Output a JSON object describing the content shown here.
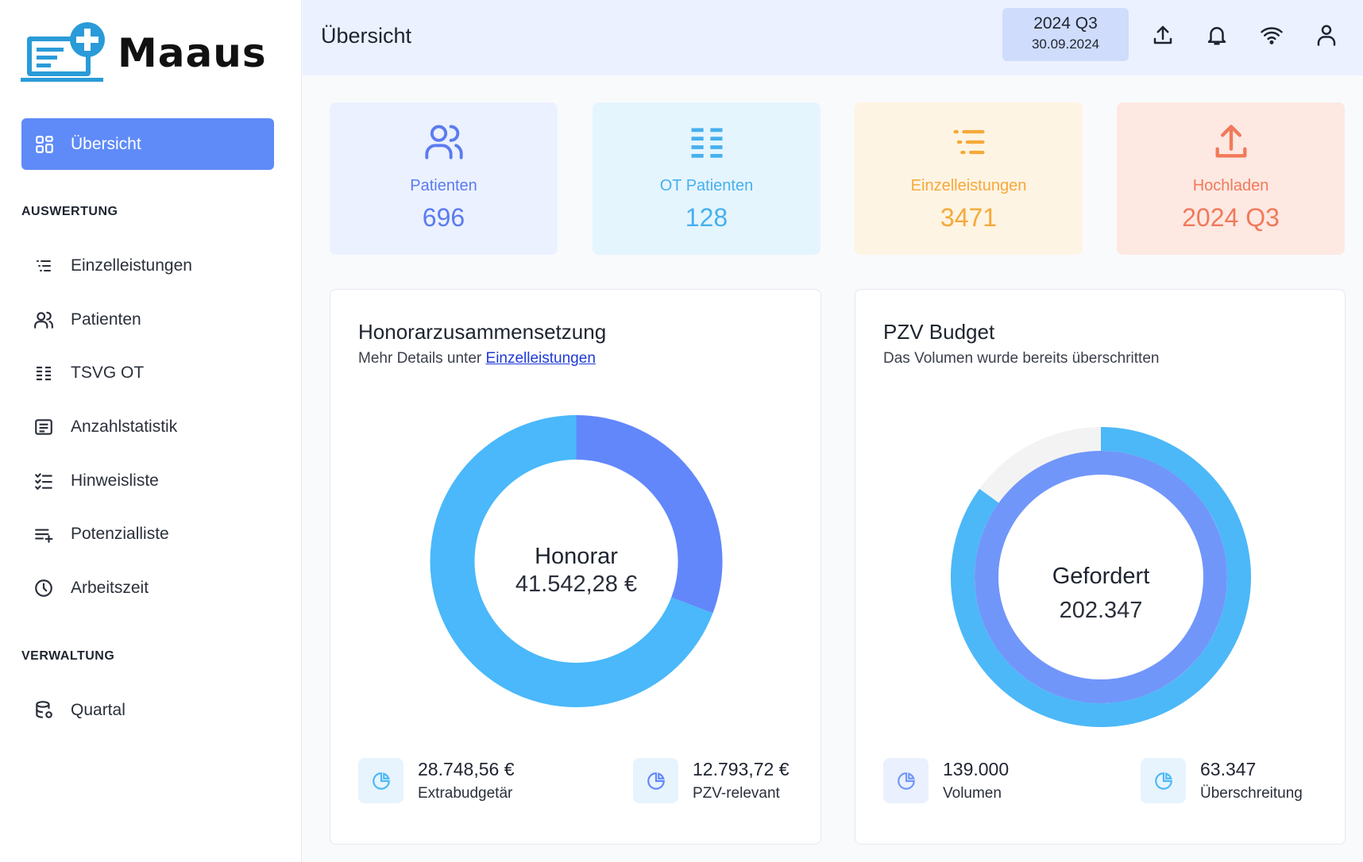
{
  "app": {
    "name": "Maaus"
  },
  "sidebar": {
    "active_item": "Übersicht",
    "section_auswertung": "AUSWERTUNG",
    "section_verwaltung": "VERWALTUNG",
    "items": [
      {
        "label": "Einzelleistungen",
        "icon": "list-icon"
      },
      {
        "label": "Patienten",
        "icon": "users-icon"
      },
      {
        "label": "TSVG OT",
        "icon": "table-list-icon"
      },
      {
        "label": "Anzahlstatistik",
        "icon": "document-list-icon"
      },
      {
        "label": "Hinweisliste",
        "icon": "checklist-icon"
      },
      {
        "label": "Potenzialliste",
        "icon": "playlist-add-icon"
      },
      {
        "label": "Arbeitszeit",
        "icon": "clock-icon"
      }
    ],
    "admin_items": [
      {
        "label": "Quartal",
        "icon": "database-icon"
      }
    ]
  },
  "header": {
    "title": "Übersicht",
    "quarter": "2024 Q3",
    "date": "30.09.2024"
  },
  "stats": [
    {
      "label": "Patienten",
      "value": "696",
      "color": "#5b7bf0",
      "bg": "#ebf1fe"
    },
    {
      "label": "OT Patienten",
      "value": "128",
      "color": "#47b0ee",
      "bg": "#e5f5fe"
    },
    {
      "label": "Einzelleistungen",
      "value": "3471",
      "color": "#f5a93a",
      "bg": "#fef4e3"
    },
    {
      "label": "Hochladen",
      "value": "2024 Q3",
      "color": "#f07a5a",
      "bg": "#fde8e2"
    }
  ],
  "honorar": {
    "title": "Honorarzusammensetzung",
    "subtitle_prefix": "Mehr Details unter",
    "subtitle_link": "Einzelleistungen",
    "center_label": "Honorar",
    "center_value": "41.542,28 €",
    "legend": [
      {
        "value": "28.748,56 €",
        "label": "Extrabudgetär"
      },
      {
        "value": "12.793,72 €",
        "label": "PZV-relevant"
      }
    ]
  },
  "pzv": {
    "title": "PZV Budget",
    "subtitle": "Das Volumen wurde bereits überschritten",
    "center_label": "Gefordert",
    "center_value": "202.347",
    "legend": [
      {
        "value": "139.000",
        "label": "Volumen"
      },
      {
        "value": "63.347",
        "label": "Überschreitung"
      }
    ]
  },
  "chart_data": [
    {
      "type": "pie",
      "title": "Honorarzusammensetzung",
      "categories": [
        "Extrabudgetär",
        "PZV-relevant"
      ],
      "values": [
        28748.56,
        12793.72
      ],
      "colors": [
        "#4ab8fa",
        "#6287fb"
      ]
    },
    {
      "type": "pie",
      "title": "PZV Budget",
      "series": [
        {
          "name": "Gefordert",
          "values": [
            202347
          ],
          "color": "#4cb8f8"
        },
        {
          "name": "Volumen",
          "values": [
            139000
          ],
          "color": "#7196fa"
        }
      ],
      "colors": [
        "#4cb8f8",
        "#7196fa",
        "#f3f3f3"
      ]
    }
  ]
}
